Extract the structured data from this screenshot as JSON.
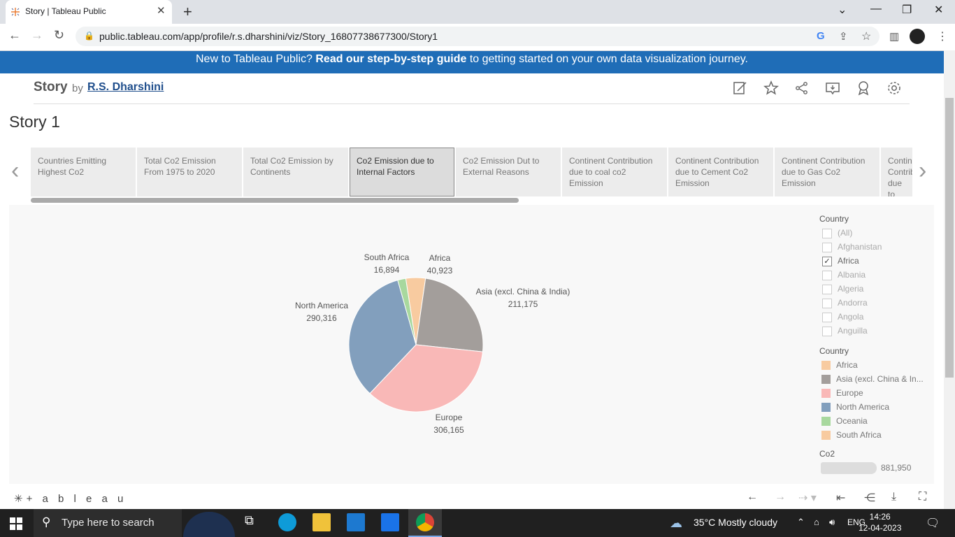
{
  "browser": {
    "tab_title": "Story | Tableau Public",
    "url": "public.tableau.com/app/profile/r.s.dharshini/viz/Story_16807738677300/Story1"
  },
  "banner": {
    "prefix": "New to Tableau Public? ",
    "link": "Read our step-by-step guide",
    "suffix": " to getting started on your own data visualization journey."
  },
  "viz": {
    "title": "Story",
    "by": "by",
    "author": "R.S. Dharshini",
    "story_title": "Story 1"
  },
  "story_points": [
    {
      "label": "Countries Emitting Highest Co2",
      "active": false
    },
    {
      "label": "Total Co2 Emission From 1975 to 2020",
      "active": false
    },
    {
      "label": "Total Co2 Emission by Continents",
      "active": false
    },
    {
      "label": "Co2 Emission due to Internal Factors",
      "active": true
    },
    {
      "label": "Co2 Emission Dut to External Reasons",
      "active": false
    },
    {
      "label": "Continent Contribution due to coal co2 Emission",
      "active": false
    },
    {
      "label": "Continent Contribution due to Cement Co2 Emission",
      "active": false
    },
    {
      "label": "Continent Contribution due to Gas Co2 Emission",
      "active": false
    },
    {
      "label": "Continent Contribution due to Flaring",
      "active": false
    }
  ],
  "chart_data": {
    "type": "pie",
    "slices": [
      {
        "name": "Africa",
        "label": "40,923",
        "value": 40923,
        "color": "#f8cba0"
      },
      {
        "name": "Asia (excl. China & India)",
        "label": "211,175",
        "value": 211175,
        "color": "#a39e9b"
      },
      {
        "name": "Europe",
        "label": "306,165",
        "value": 306165,
        "color": "#f9b8b7"
      },
      {
        "name": "North America",
        "label": "290,316",
        "value": 290316,
        "color": "#829fbd"
      },
      {
        "name": "South Africa",
        "label": "16,894",
        "value": 16894,
        "color": "#a8d89e"
      }
    ]
  },
  "filter": {
    "title": "Country",
    "items": [
      {
        "label": "(All)",
        "checked": false
      },
      {
        "label": "Afghanistan",
        "checked": false
      },
      {
        "label": "Africa",
        "checked": true
      },
      {
        "label": "Albania",
        "checked": false
      },
      {
        "label": "Algeria",
        "checked": false
      },
      {
        "label": "Andorra",
        "checked": false
      },
      {
        "label": "Angola",
        "checked": false
      },
      {
        "label": "Anguilla",
        "checked": false
      }
    ]
  },
  "legend": {
    "title": "Country",
    "items": [
      {
        "label": "Africa",
        "color": "#f8cba0"
      },
      {
        "label": "Asia (excl. China & In...",
        "color": "#a39e9b"
      },
      {
        "label": "Europe",
        "color": "#f9b8b7"
      },
      {
        "label": "North America",
        "color": "#829fbd"
      },
      {
        "label": "Oceania",
        "color": "#a8d89e"
      },
      {
        "label": "South Africa",
        "color": "#f8cba0"
      }
    ]
  },
  "size_legend": {
    "title": "Co2",
    "max_label": "881,950"
  },
  "footer": {
    "logo": "+ a b l e a u"
  },
  "taskbar": {
    "search_placeholder": "Type here to search",
    "weather": "35°C  Mostly cloudy",
    "lang": "ENG",
    "time": "14:26",
    "date": "12-04-2023"
  }
}
